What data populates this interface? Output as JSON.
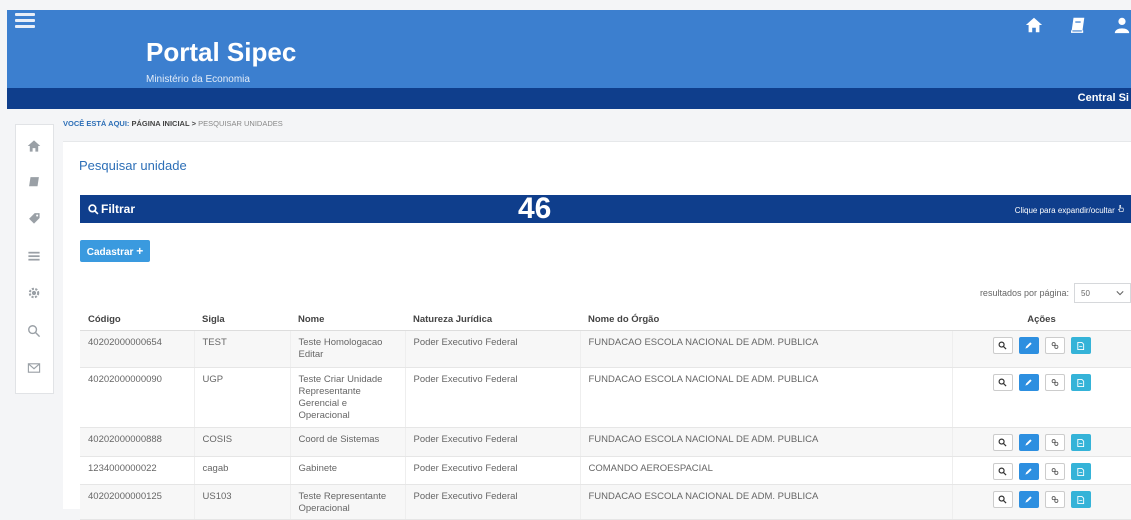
{
  "header": {
    "title": "Portal Sipec",
    "subtitle": "Ministério da Economia",
    "subbar_right": "Central Si"
  },
  "breadcrumb": {
    "label": "VOCÊ ESTÁ AQUI:",
    "home": "PÁGINA INICIAL",
    "separator": ">",
    "current": "PESQUISAR UNIDADES"
  },
  "page": {
    "title": "Pesquisar unidade",
    "overlay_number": "46"
  },
  "filter": {
    "label": "Filtrar",
    "hint": "Clique para expandir/ocultar"
  },
  "actions": {
    "cadastrar_label": "Cadastrar"
  },
  "pagination": {
    "per_page_label": "resultados por página:",
    "per_page_value": "50"
  },
  "table": {
    "headers": [
      "Código",
      "Sigla",
      "Nome",
      "Natureza Jurídica",
      "Nome do Órgão",
      "Ações"
    ],
    "rows": [
      {
        "codigo": "40202000000654",
        "sigla": "TEST",
        "nome": "Teste Homologacao Editar",
        "natureza": "Poder Executivo Federal",
        "orgao": "FUNDACAO ESCOLA NACIONAL DE ADM. PUBLICA"
      },
      {
        "codigo": "40202000000090",
        "sigla": "UGP",
        "nome": "Teste Criar Unidade Representante Gerencial e Operacional",
        "natureza": "Poder Executivo Federal",
        "orgao": "FUNDACAO ESCOLA NACIONAL DE ADM. PUBLICA"
      },
      {
        "codigo": "40202000000888",
        "sigla": "COSIS",
        "nome": "Coord de Sistemas",
        "natureza": "Poder Executivo Federal",
        "orgao": "FUNDACAO ESCOLA NACIONAL DE ADM. PUBLICA"
      },
      {
        "codigo": "1234000000022",
        "sigla": "cagab",
        "nome": "Gabinete",
        "natureza": "Poder Executivo Federal",
        "orgao": "COMANDO AEROESPACIAL"
      },
      {
        "codigo": "40202000000125",
        "sigla": "US103",
        "nome": "Teste Representante Operacional",
        "natureza": "Poder Executivo Federal",
        "orgao": "FUNDACAO ESCOLA NACIONAL DE ADM. PUBLICA"
      }
    ]
  },
  "colors": {
    "topbar": "#3c7fcf",
    "navy": "#0f3e8c",
    "accent": "#2d6fb7",
    "button": "#3a9adf"
  },
  "icons": {
    "menu": "hamburger-icon",
    "top": [
      "home-icon",
      "book-icon",
      "user-icon"
    ],
    "rail": [
      "home-icon",
      "book-icon",
      "tag-icon",
      "list-icon",
      "gear-icon",
      "search-icon",
      "mail-icon"
    ],
    "row_actions": [
      "search-icon",
      "pencil-icon",
      "link-icon",
      "document-icon"
    ]
  }
}
